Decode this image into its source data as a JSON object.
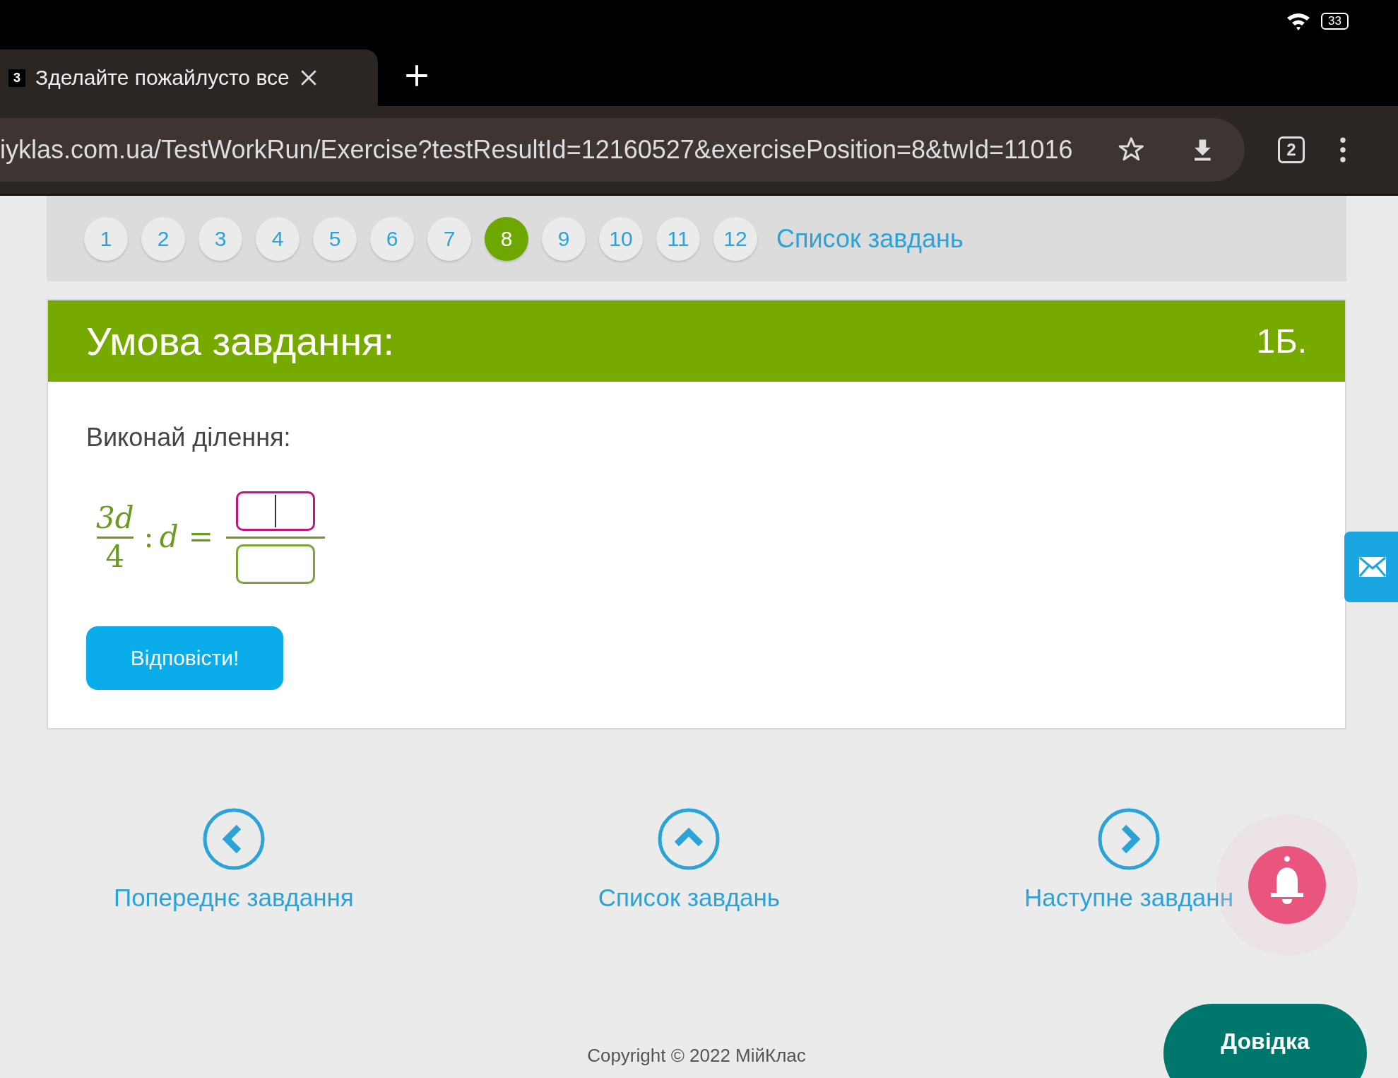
{
  "status_bar": {
    "battery": "33"
  },
  "browser": {
    "tab": {
      "favicon": "3",
      "title": "Зделайте пожайлусто все"
    },
    "url": "iyklas.com.ua/TestWorkRun/Exercise?testResultId=12160527&exercisePosition=8&twId=11016",
    "tab_count": "2"
  },
  "pagination": {
    "pages": [
      {
        "label": "1",
        "selected": false
      },
      {
        "label": "2",
        "selected": false
      },
      {
        "label": "3",
        "selected": false
      },
      {
        "label": "4",
        "selected": false
      },
      {
        "label": "5",
        "selected": false
      },
      {
        "label": "6",
        "selected": false
      },
      {
        "label": "7",
        "selected": false
      },
      {
        "label": "8",
        "selected": true
      },
      {
        "label": "9",
        "selected": false
      },
      {
        "label": "10",
        "selected": false
      },
      {
        "label": "11",
        "selected": false
      },
      {
        "label": "12",
        "selected": false
      }
    ],
    "list_link": "Список завдань"
  },
  "task": {
    "title": "Умова завдання:",
    "points": "1Б.",
    "prompt": "Виконай ділення:",
    "expression": {
      "numerator": "3d",
      "denominator": "4",
      "operator": ":",
      "variable": "d",
      "equals": "="
    },
    "answer_fields": [
      {
        "kind": "numerator",
        "focused": true
      },
      {
        "kind": "denominator",
        "focused": false
      }
    ],
    "submit": "Відповісти!"
  },
  "navigation": [
    {
      "kind": "prev",
      "label": "Попереднє завдання"
    },
    {
      "kind": "up",
      "label": "Список завдань"
    },
    {
      "kind": "next",
      "label": "Наступне завданн"
    }
  ],
  "help_button": "Довідка",
  "footer": "Copyright © 2022 МійКлас"
}
